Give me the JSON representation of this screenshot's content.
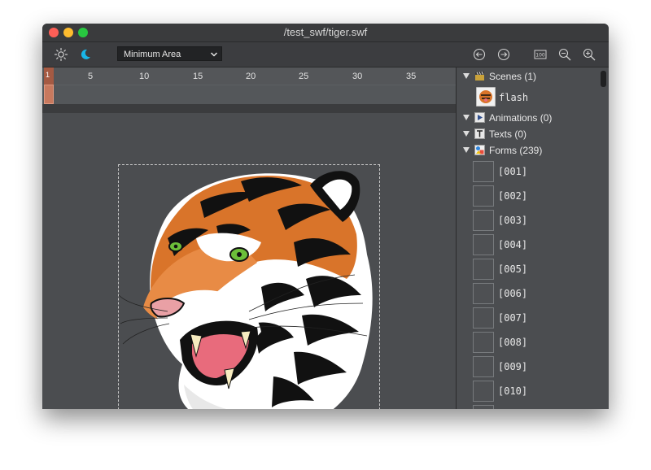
{
  "window": {
    "title": "/test_swf/tiger.swf"
  },
  "toolbar": {
    "zoom_mode": "Minimum Area",
    "icons": [
      "sun-icon",
      "moon-icon",
      "circle-left-arrow-icon",
      "circle-right-arrow-icon",
      "zoom-100-icon",
      "zoom-out-icon",
      "zoom-in-icon"
    ],
    "zoom100_label": "100"
  },
  "timeline": {
    "current_frame": "1",
    "ticks": [
      "5",
      "10",
      "15",
      "20",
      "25",
      "30",
      "35"
    ]
  },
  "tree": {
    "scenes": {
      "label": "Scenes (1)",
      "items": [
        {
          "label": "flash"
        }
      ]
    },
    "animations": {
      "label": "Animations (0)"
    },
    "texts": {
      "label": "Texts (0)"
    },
    "forms": {
      "label": "Forms (239)",
      "items": [
        "[001]",
        "[002]",
        "[003]",
        "[004]",
        "[005]",
        "[006]",
        "[007]",
        "[008]",
        "[009]",
        "[010]"
      ]
    }
  },
  "colors": {
    "accent_playhead": "#c8795e",
    "window_bg": "#4b4d50",
    "tiger_orange": "#d9742a"
  }
}
